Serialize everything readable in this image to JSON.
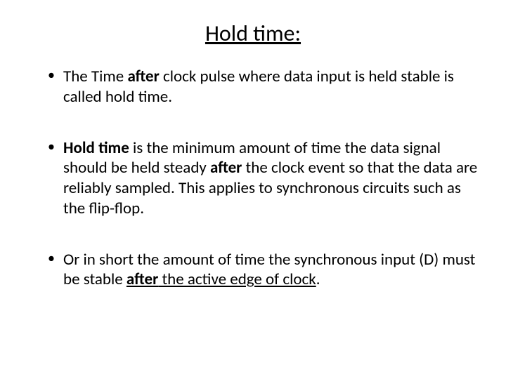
{
  "title": "Hold time:",
  "bullets": {
    "b1": {
      "t1": "The Time ",
      "t2": "after",
      "t3": " clock pulse where data input is held stable is called hold time."
    },
    "b2": {
      "t1": "Hold time",
      "t2": " is the minimum amount of time the data signal should be held steady ",
      "t3": "after",
      "t4": " the clock event so that the data are reliably sampled. This applies to synchronous circuits such as the flip-flop."
    },
    "b3": {
      "t1": "Or in short  the amount of time the synchronous input (D) must be stable ",
      "t2": "after",
      "t3": " the active edge of clock",
      "t4": "."
    }
  }
}
